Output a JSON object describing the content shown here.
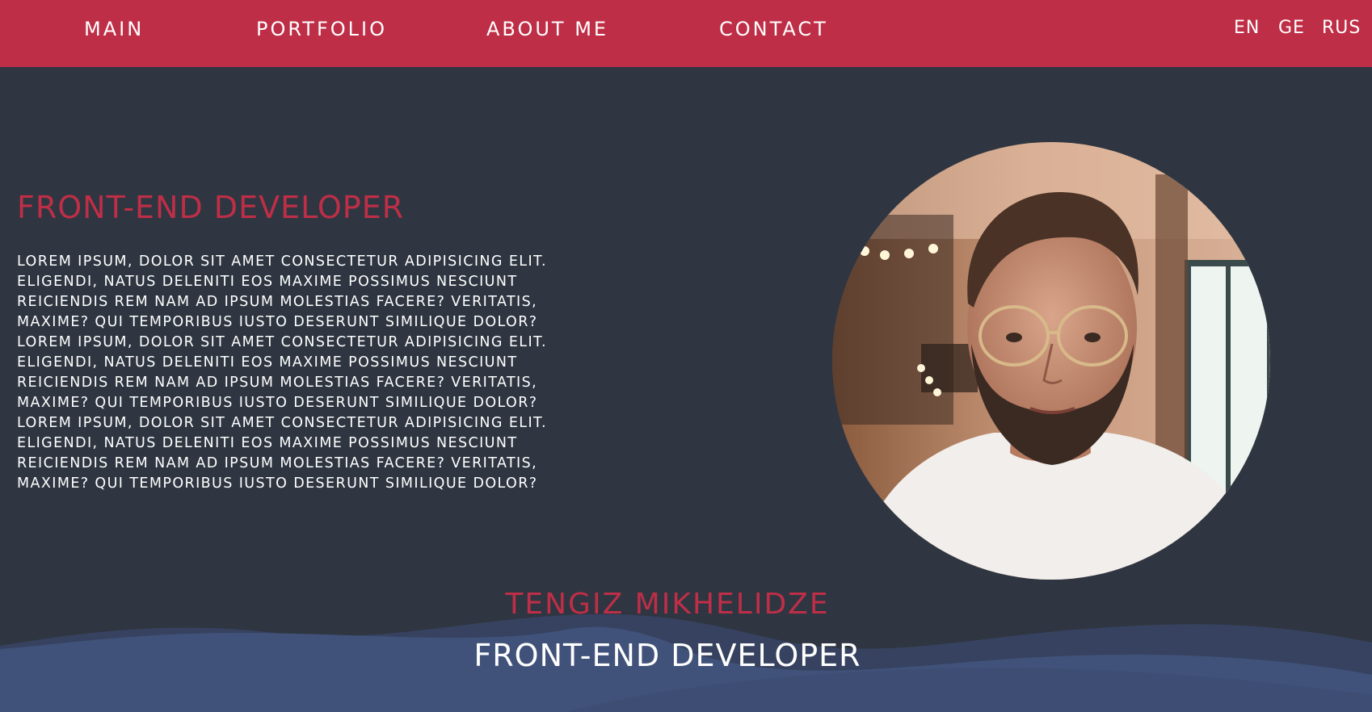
{
  "nav": {
    "links": [
      "Main",
      "Portfolio",
      "About me",
      "Contact"
    ],
    "languages": [
      "EN",
      "GE",
      "RUS"
    ]
  },
  "hero": {
    "title": "Front-End Developer",
    "text": "Lorem ipsum, dolor sit amet consectetur adipisicing elit. Eligendi, natus deleniti eos maxime possimus nesciunt reiciendis rem nam ad ipsum molestias facere? Veritatis, maxime? Qui temporibus iusto deserunt similique dolor? Lorem ipsum, dolor sit amet consectetur adipisicing elit. Eligendi, natus deleniti eos maxime possimus nesciunt reiciendis rem nam ad ipsum molestias facere? Veritatis, maxime? Qui temporibus iusto deserunt similique dolor? Lorem ipsum, dolor sit amet consectetur adipisicing elit. Eligendi, natus deleniti eos maxime possimus nesciunt reiciendis rem nam ad ipsum molestias facere? Veritatis, maxime? Qui temporibus iusto deserunt similique dolor?"
  },
  "footer": {
    "name": "Tengiz Mikhelidze",
    "role": "Front-End Developer"
  },
  "colors": {
    "brand_red": "#bf2e47",
    "background": "#2f3641",
    "wave_blue": "#41527a",
    "text_light": "#ffffff"
  }
}
